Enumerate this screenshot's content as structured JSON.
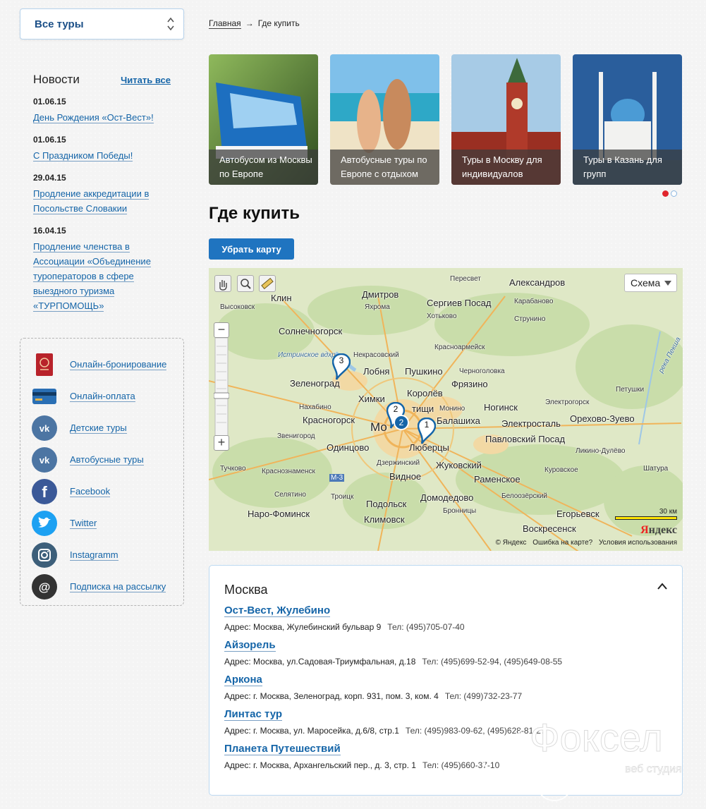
{
  "sidebar": {
    "tours_select": "Все туры",
    "news": {
      "title": "Новости",
      "read_all": "Читать все",
      "items": [
        {
          "date": "01.06.15",
          "title": "День Рождения «Ост-Вест»!"
        },
        {
          "date": "01.06.15",
          "title": "С Праздником Победы!"
        },
        {
          "date": "29.04.15",
          "title": "Продление аккредитации в Посольстве Словакии"
        },
        {
          "date": "16.04.15",
          "title": "Продление членства в Ассоциации «Объединение туроператоров в сфере выездного туризма «ТУРПОМОЩЬ»"
        }
      ]
    },
    "links": [
      {
        "label": "Онлайн-бронирование",
        "icon": "passport-icon"
      },
      {
        "label": "Онлайн-оплата",
        "icon": "credit-card-icon"
      },
      {
        "label": "Детские туры",
        "icon": "vk-icon"
      },
      {
        "label": "Автобусные туры",
        "icon": "vk-icon"
      },
      {
        "label": "Facebook",
        "icon": "facebook-icon"
      },
      {
        "label": "Twitter",
        "icon": "twitter-icon"
      },
      {
        "label": "Instagramm",
        "icon": "instagram-icon"
      },
      {
        "label": "Подписка на рассылку",
        "icon": "email-at-icon"
      }
    ]
  },
  "breadcrumb": {
    "home": "Главная",
    "separator": "→",
    "current": "Где купить"
  },
  "promo": [
    {
      "caption": "Автобусом из Москвы по Европе"
    },
    {
      "caption": "Автобусные туры по Европе с отдыхом"
    },
    {
      "caption": "Туры в Москву для индивидуалов"
    },
    {
      "caption": "Туры в Казань для групп"
    }
  ],
  "page_title": "Где купить",
  "hide_map_button": "Убрать карту",
  "map": {
    "scheme": "Схема",
    "scale": "30 км",
    "logo": "Яндекс",
    "copyright": "© Яндекс",
    "error_link": "Ошибка на карте?",
    "terms_link": "Условия использования",
    "markers": [
      "1",
      "2",
      "3",
      "2"
    ],
    "labels": {
      "peresvet": "Пересвет",
      "aleksandrov": "Александров",
      "dmitrov": "Дмитров",
      "klin": "Клин",
      "vysokovsk": "Высоковск",
      "yakhroma": "Яхрома",
      "sergiev": "Сергиев Посад",
      "karabanovo": "Карабаново",
      "khotkovo": "Хотьково",
      "strunino": "Струнино",
      "solnechnogorsk": "Солнечногорск",
      "krasnoarmeysk": "Красноармейск",
      "nekrasovsky": "Некрасовский",
      "istra_res": "Истринское вдхр.",
      "lobnya": "Лобня",
      "pushkino": "Пушкино",
      "chernogolovka": "Черноголовка",
      "zelenograd": "Зеленоград",
      "fryazino": "Фрязино",
      "reka_peksha": "река Пекша",
      "khimki": "Химки",
      "korolev": "Королёв",
      "petushki": "Петушки",
      "nakhabino": "Нахабино",
      "mytishchi": "тищи",
      "monino": "Монино",
      "noginsk": "Ногинск",
      "elektrogorsk": "Электрогорск",
      "krasnogorsk": "Красногорск",
      "moscow": "Мо",
      "balashikha": "Балашиха",
      "orekhovo": "Орехово-Зуево",
      "zvenigorod": "Звенигород",
      "elektrostal": "Электросталь",
      "odintsovo": "Одинцово",
      "lyubertsy": "Люберцы",
      "pavlovsky": "Павловский Посад",
      "likino": "Ликино-Дулёво",
      "dzerzhinsky": "Дзержинский",
      "zhukovsky": "Жуковский",
      "tuchkovo": "Тучково",
      "krasnoznamensk": "Краснознаменск",
      "kurovskoe": "Куровское",
      "m3": "М-3",
      "vidnoe": "Видное",
      "ramenskoe": "Раменское",
      "selyatino": "Селятино",
      "troitsk": "Троицк",
      "domodedovo": "Домодедово",
      "beloomut": "Белоозёрский",
      "naro": "Наро-Фоминск",
      "podolsk": "Подольск",
      "bronnitsy": "Бронницы",
      "egoryevsk": "Егорьевск",
      "klimovsk": "Климовск",
      "voskresensk": "Воскресенск",
      "shatura": "Шатура"
    }
  },
  "offices": {
    "city": "Москва",
    "items": [
      {
        "name": "Ост-Вест, Жулебино",
        "address": "Адрес: Москва, Жулебинский бульвар 9",
        "phone": "Тел: (495)705-07-40"
      },
      {
        "name": "Айзорель",
        "address": "Адрес: Москва, ул.Садовая-Триумфальная, д.18",
        "phone": "Тел: (495)699-52-94, (495)649-08-55"
      },
      {
        "name": "Аркона",
        "address": "Адрес: г. Москва, Зеленоград, корп. 931, пом. 3, ком. 4",
        "phone": "Тел: (499)732-23-77"
      },
      {
        "name": "Линтас тур",
        "address": "Адрес: г. Москва, ул. Маросейка, д.6/8, стр.1",
        "phone": "Тел: (495)983-09-62, (495)628-81-27"
      },
      {
        "name": "Планета Путешествий",
        "address": "Адрес: г. Москва, Архангельский пер., д. 3, стр. 1",
        "phone": "Тел: (495)660-37-10"
      }
    ]
  },
  "watermark": {
    "brand": "Фоксел",
    "sub": "веб студия"
  },
  "colors": {
    "accent": "#1f74c0",
    "link": "#1565a8",
    "dot_active": "#e0262d"
  }
}
